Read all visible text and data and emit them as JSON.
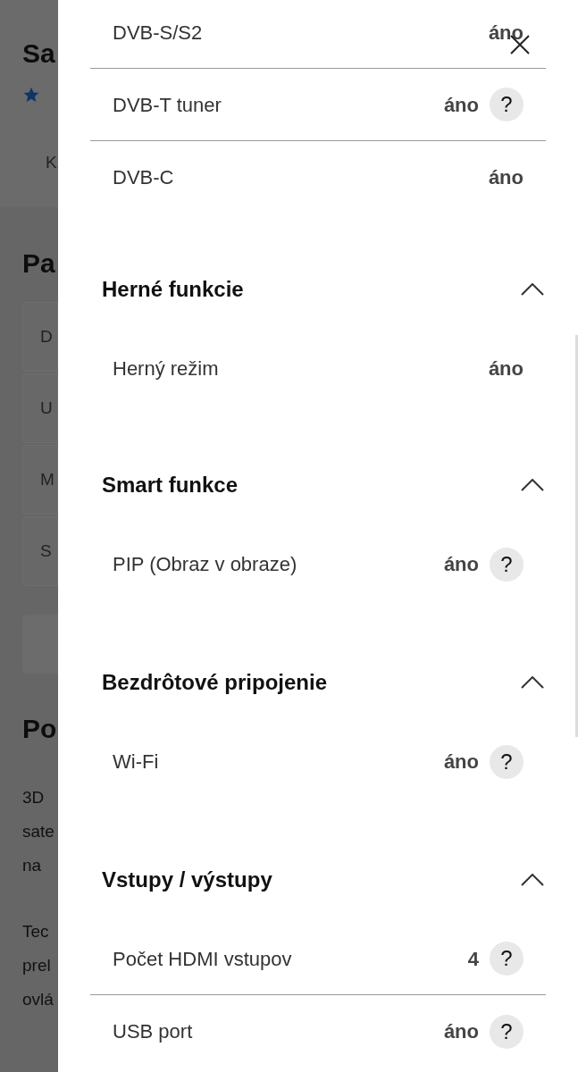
{
  "background_page": {
    "title": "Sa",
    "tab": "K",
    "section_title": "Pa",
    "cards": [
      "D",
      "U",
      "M",
      "S"
    ],
    "description_title": "Po",
    "paragraphs": [
      [
        "3D",
        "sate",
        "na"
      ],
      [
        "Tec",
        "prel",
        "ovlá"
      ]
    ]
  },
  "drawer": {
    "sections": [
      {
        "rows": [
          {
            "label": "DVB-S/S2",
            "value": "áno"
          },
          {
            "label": "DVB-T tuner",
            "value": "áno",
            "help": "?"
          },
          {
            "label": "DVB-C",
            "value": "áno"
          }
        ]
      },
      {
        "title": "Herné funkcie",
        "expanded": true,
        "rows": [
          {
            "label": "Herný režim",
            "value": "áno"
          }
        ]
      },
      {
        "title": "Smart funkce",
        "expanded": true,
        "rows": [
          {
            "label": "PIP (Obraz v obraze)",
            "value": "áno",
            "help": "?"
          }
        ]
      },
      {
        "title": "Bezdrôtové pripojenie",
        "expanded": true,
        "rows": [
          {
            "label": "Wi-Fi",
            "value": "áno",
            "help": "?"
          }
        ]
      },
      {
        "title": "Vstupy / výstupy",
        "expanded": true,
        "rows": [
          {
            "label": "Počet HDMI vstupov",
            "value": "4",
            "help": "?"
          },
          {
            "label": "USB port",
            "value": "áno",
            "help": "?"
          }
        ]
      }
    ]
  }
}
